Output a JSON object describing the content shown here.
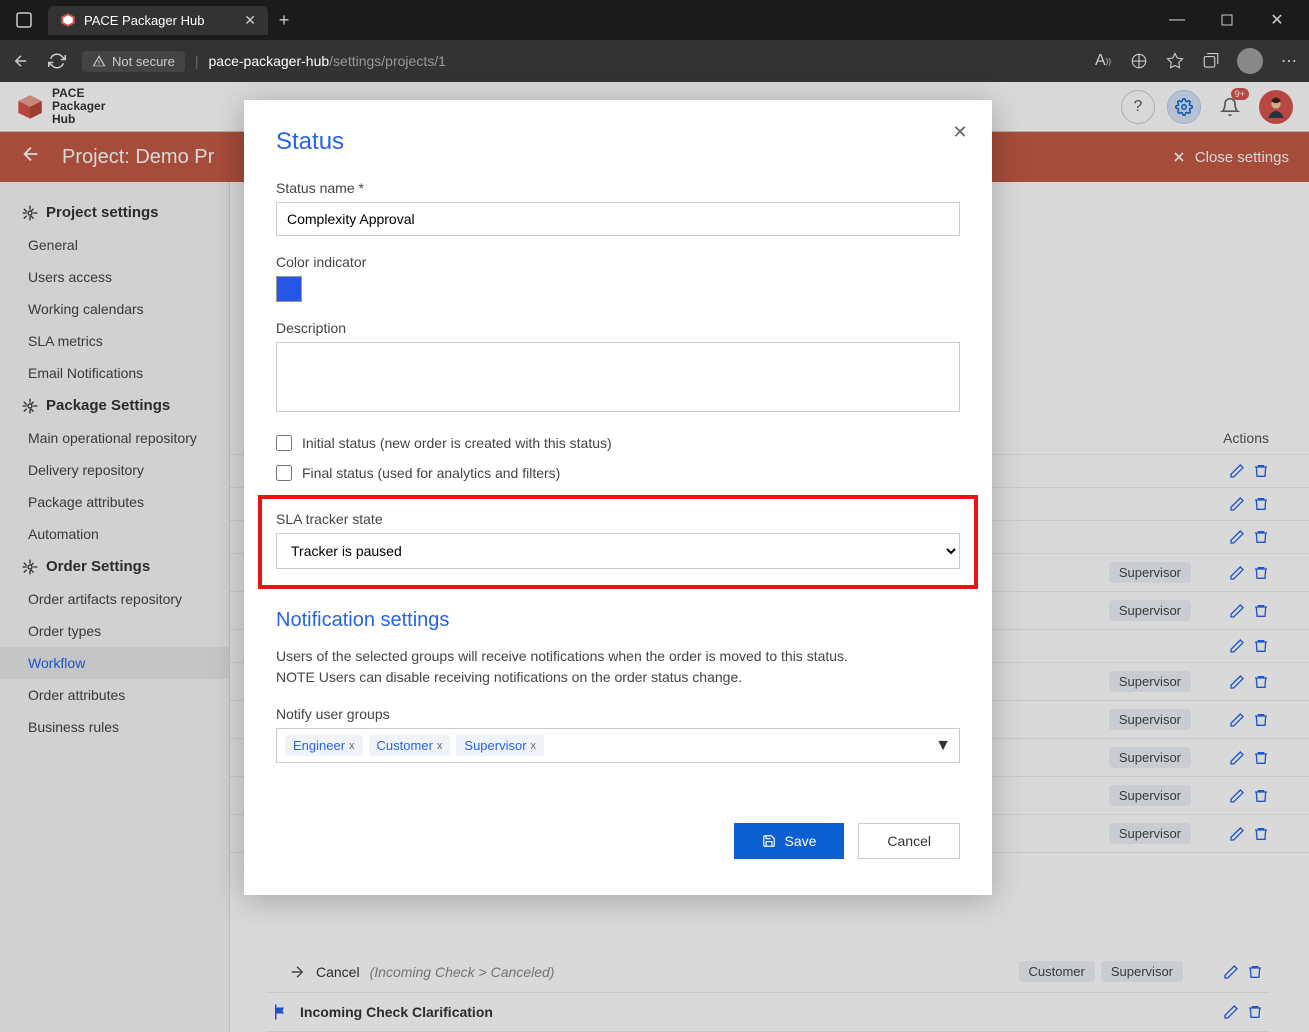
{
  "browser": {
    "tab_title": "PACE Packager Hub",
    "not_secure": "Not secure",
    "url_host": "pace-packager-hub",
    "url_path": "/settings/projects/1"
  },
  "app_header": {
    "logo_line1": "PACE",
    "logo_line2": "Packager",
    "logo_line3": "Hub",
    "bell_badge": "9+"
  },
  "breadcrumb": {
    "title": "Project: Demo Pr",
    "close": "Close settings"
  },
  "sidebar": {
    "groups": [
      {
        "header": "Project settings",
        "items": [
          "General",
          "Users access",
          "Working calendars",
          "SLA metrics",
          "Email Notifications"
        ]
      },
      {
        "header": "Package Settings",
        "items": [
          "Main operational repository",
          "Delivery repository",
          "Package attributes",
          "Automation"
        ]
      },
      {
        "header": "Order Settings",
        "items": [
          "Order artifacts repository",
          "Order types",
          "Workflow",
          "Order attributes",
          "Business rules"
        ]
      }
    ],
    "active": "Workflow"
  },
  "bg_table": {
    "actions_header": "Actions",
    "rows": [
      {
        "tags": []
      },
      {
        "tags": []
      },
      {
        "tags": []
      },
      {
        "tags": [
          "Supervisor"
        ]
      },
      {
        "tags": [
          "Supervisor"
        ]
      },
      {
        "tags": []
      },
      {
        "tags": [
          "Supervisor"
        ]
      },
      {
        "tags": [
          "Supervisor"
        ]
      },
      {
        "tags": [
          "Supervisor"
        ]
      },
      {
        "tags": [
          "Supervisor"
        ]
      },
      {
        "tags": [
          "Supervisor"
        ]
      }
    ],
    "last_transition": {
      "label": "Cancel",
      "from": "Incoming Check",
      "to": "Canceled",
      "tags": [
        "Customer",
        "Supervisor"
      ]
    },
    "last_status": {
      "label": "Incoming Check Clarification"
    }
  },
  "modal": {
    "title": "Status",
    "labels": {
      "name": "Status name *",
      "color": "Color indicator",
      "description": "Description",
      "initial": "Initial status (new order is created with this status)",
      "final": "Final status (used for analytics and filters)",
      "sla": "SLA tracker state",
      "notif_title": "Notification settings",
      "notif_text1": "Users of the selected groups will receive notifications when the order is moved to this status.",
      "notif_text2": "NOTE Users can disable receiving notifications on the order status change.",
      "notify_groups": "Notify user groups"
    },
    "values": {
      "name": "Complexity Approval",
      "color": "#2556e5",
      "description": "",
      "initial": false,
      "final": false,
      "sla": "Tracker is paused",
      "groups": [
        "Engineer",
        "Customer",
        "Supervisor"
      ]
    },
    "buttons": {
      "save": "Save",
      "cancel": "Cancel"
    }
  }
}
